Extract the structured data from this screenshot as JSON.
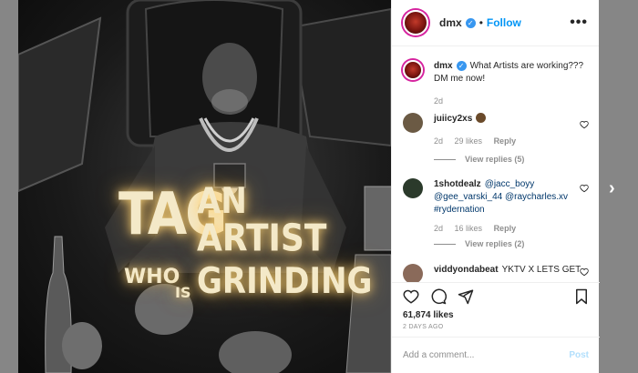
{
  "post": {
    "author": "dmx",
    "follow_label": "Follow",
    "dot": "•",
    "more": "•••",
    "poster": {
      "line1a": "TAG",
      "line1b": "AN",
      "line2": "ARTIST",
      "line3a": "WHO",
      "line3b": "IS",
      "line3c": "GRINDING"
    },
    "caption": {
      "user": "dmx",
      "text": "What Artists are working??? DM me now!",
      "time": "2d"
    },
    "comments": [
      {
        "user": "juiicy2xs",
        "text": "",
        "time": "2d",
        "likes": "29 likes",
        "reply": "Reply",
        "view_replies": "View replies (5)"
      },
      {
        "user": "1shotdealz",
        "text": "@jacc_boyy @gee_varski_44 @raycharles.xv #rydernation",
        "time": "2d",
        "likes": "16 likes",
        "reply": "Reply",
        "view_replies": "View replies (2)"
      },
      {
        "user": "viddyondabeat",
        "text": "YKTV X LETS GET"
      }
    ],
    "likes_count": "61,874 likes",
    "posted_ago": "2 DAYS AGO",
    "comment_placeholder": "Add a comment...",
    "post_label": "Post",
    "next_arrow": "›"
  },
  "colors": {
    "accent": "#0095f6",
    "verified": "#3897f0",
    "post_disabled": "#b2dffc",
    "muted": "#8e8e8e",
    "link": "#00376b"
  },
  "icons": [
    "verified-badge-icon",
    "heart-icon",
    "comment-icon",
    "share-icon",
    "bookmark-icon",
    "chevron-right-icon",
    "clapping-emoji-icon"
  ]
}
